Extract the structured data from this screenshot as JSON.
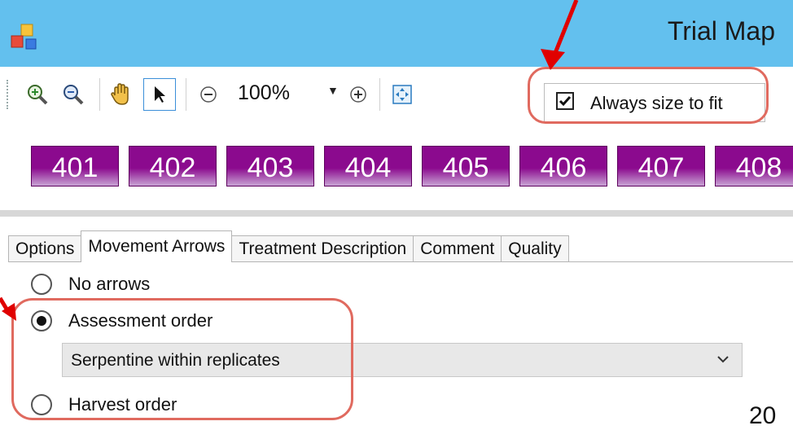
{
  "window": {
    "title": "Trial Map"
  },
  "toolbar": {
    "zoom_in_tooltip": "",
    "zoom_value": "100%",
    "always_size_to_fit": {
      "label": "Always size to fit",
      "checked": true
    }
  },
  "plots": [
    "401",
    "402",
    "403",
    "404",
    "405",
    "406",
    "407",
    "408"
  ],
  "tabs": [
    {
      "label": "Options",
      "active": false
    },
    {
      "label": "Movement Arrows",
      "active": true
    },
    {
      "label": "Treatment Description",
      "active": false
    },
    {
      "label": "Comment",
      "active": false
    },
    {
      "label": "Quality",
      "active": false
    }
  ],
  "movement": {
    "options": [
      {
        "label": "No arrows",
        "selected": false
      },
      {
        "label": "Assessment order",
        "selected": true
      },
      {
        "label": "Harvest order",
        "selected": false
      }
    ],
    "order_select": {
      "value": "Serpentine within replicates"
    }
  },
  "page_number": "20",
  "colors": {
    "titlebar": "#63c0ee",
    "plot_fill": "#8b0a8e",
    "highlight": "#e06a5f",
    "arrow": "#e00000"
  }
}
